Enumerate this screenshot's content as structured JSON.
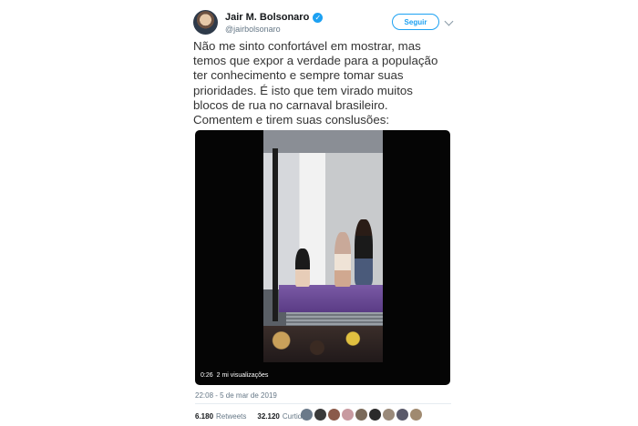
{
  "author": {
    "name": "Jair M. Bolsonaro",
    "handle": "@jairbolsonaro",
    "verified_icon": "verified-badge-icon",
    "avatar_icon": "profile-avatar"
  },
  "follow_button": {
    "label": "Seguir"
  },
  "tweet_text": "Não me sinto confortável em mostrar, mas\ntemos que expor a verdade para a população\nter conhecimento e sempre tomar suas\nprioridades. É isto que tem virado muitos\nblocos de rua no carnaval brasileiro.\nComentem e tirem suas conslusões:",
  "video": {
    "duration": "0:26",
    "views": "2 mi visualizações"
  },
  "timestamp": "22:08 - 5 de mar de 2019",
  "stats": {
    "retweets_count": "6.180",
    "retweets_label": "Retweets",
    "likes_count": "32.120",
    "likes_label": "Curtidas"
  },
  "colors": {
    "accent": "#1da1f2",
    "text": "#14171a",
    "muted": "#657786",
    "liker_avatars": [
      "#6b7a8a",
      "#3a3a3a",
      "#8a5a4a",
      "#c89aa0",
      "#7a6a5a",
      "#2a2a2a",
      "#9a8a7a",
      "#5a5a6a",
      "#a08a70"
    ]
  }
}
